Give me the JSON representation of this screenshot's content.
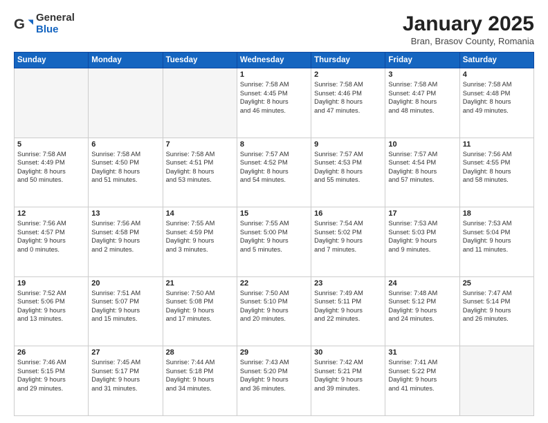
{
  "logo": {
    "general": "General",
    "blue": "Blue"
  },
  "title": "January 2025",
  "location": "Bran, Brasov County, Romania",
  "weekdays": [
    "Sunday",
    "Monday",
    "Tuesday",
    "Wednesday",
    "Thursday",
    "Friday",
    "Saturday"
  ],
  "weeks": [
    [
      {
        "day": "",
        "lines": [],
        "empty": true
      },
      {
        "day": "",
        "lines": [],
        "empty": true
      },
      {
        "day": "",
        "lines": [],
        "empty": true
      },
      {
        "day": "1",
        "lines": [
          "Sunrise: 7:58 AM",
          "Sunset: 4:45 PM",
          "Daylight: 8 hours",
          "and 46 minutes."
        ]
      },
      {
        "day": "2",
        "lines": [
          "Sunrise: 7:58 AM",
          "Sunset: 4:46 PM",
          "Daylight: 8 hours",
          "and 47 minutes."
        ]
      },
      {
        "day": "3",
        "lines": [
          "Sunrise: 7:58 AM",
          "Sunset: 4:47 PM",
          "Daylight: 8 hours",
          "and 48 minutes."
        ]
      },
      {
        "day": "4",
        "lines": [
          "Sunrise: 7:58 AM",
          "Sunset: 4:48 PM",
          "Daylight: 8 hours",
          "and 49 minutes."
        ]
      }
    ],
    [
      {
        "day": "5",
        "lines": [
          "Sunrise: 7:58 AM",
          "Sunset: 4:49 PM",
          "Daylight: 8 hours",
          "and 50 minutes."
        ]
      },
      {
        "day": "6",
        "lines": [
          "Sunrise: 7:58 AM",
          "Sunset: 4:50 PM",
          "Daylight: 8 hours",
          "and 51 minutes."
        ]
      },
      {
        "day": "7",
        "lines": [
          "Sunrise: 7:58 AM",
          "Sunset: 4:51 PM",
          "Daylight: 8 hours",
          "and 53 minutes."
        ]
      },
      {
        "day": "8",
        "lines": [
          "Sunrise: 7:57 AM",
          "Sunset: 4:52 PM",
          "Daylight: 8 hours",
          "and 54 minutes."
        ]
      },
      {
        "day": "9",
        "lines": [
          "Sunrise: 7:57 AM",
          "Sunset: 4:53 PM",
          "Daylight: 8 hours",
          "and 55 minutes."
        ]
      },
      {
        "day": "10",
        "lines": [
          "Sunrise: 7:57 AM",
          "Sunset: 4:54 PM",
          "Daylight: 8 hours",
          "and 57 minutes."
        ]
      },
      {
        "day": "11",
        "lines": [
          "Sunrise: 7:56 AM",
          "Sunset: 4:55 PM",
          "Daylight: 8 hours",
          "and 58 minutes."
        ]
      }
    ],
    [
      {
        "day": "12",
        "lines": [
          "Sunrise: 7:56 AM",
          "Sunset: 4:57 PM",
          "Daylight: 9 hours",
          "and 0 minutes."
        ]
      },
      {
        "day": "13",
        "lines": [
          "Sunrise: 7:56 AM",
          "Sunset: 4:58 PM",
          "Daylight: 9 hours",
          "and 2 minutes."
        ]
      },
      {
        "day": "14",
        "lines": [
          "Sunrise: 7:55 AM",
          "Sunset: 4:59 PM",
          "Daylight: 9 hours",
          "and 3 minutes."
        ]
      },
      {
        "day": "15",
        "lines": [
          "Sunrise: 7:55 AM",
          "Sunset: 5:00 PM",
          "Daylight: 9 hours",
          "and 5 minutes."
        ]
      },
      {
        "day": "16",
        "lines": [
          "Sunrise: 7:54 AM",
          "Sunset: 5:02 PM",
          "Daylight: 9 hours",
          "and 7 minutes."
        ]
      },
      {
        "day": "17",
        "lines": [
          "Sunrise: 7:53 AM",
          "Sunset: 5:03 PM",
          "Daylight: 9 hours",
          "and 9 minutes."
        ]
      },
      {
        "day": "18",
        "lines": [
          "Sunrise: 7:53 AM",
          "Sunset: 5:04 PM",
          "Daylight: 9 hours",
          "and 11 minutes."
        ]
      }
    ],
    [
      {
        "day": "19",
        "lines": [
          "Sunrise: 7:52 AM",
          "Sunset: 5:06 PM",
          "Daylight: 9 hours",
          "and 13 minutes."
        ]
      },
      {
        "day": "20",
        "lines": [
          "Sunrise: 7:51 AM",
          "Sunset: 5:07 PM",
          "Daylight: 9 hours",
          "and 15 minutes."
        ]
      },
      {
        "day": "21",
        "lines": [
          "Sunrise: 7:50 AM",
          "Sunset: 5:08 PM",
          "Daylight: 9 hours",
          "and 17 minutes."
        ]
      },
      {
        "day": "22",
        "lines": [
          "Sunrise: 7:50 AM",
          "Sunset: 5:10 PM",
          "Daylight: 9 hours",
          "and 20 minutes."
        ]
      },
      {
        "day": "23",
        "lines": [
          "Sunrise: 7:49 AM",
          "Sunset: 5:11 PM",
          "Daylight: 9 hours",
          "and 22 minutes."
        ]
      },
      {
        "day": "24",
        "lines": [
          "Sunrise: 7:48 AM",
          "Sunset: 5:12 PM",
          "Daylight: 9 hours",
          "and 24 minutes."
        ]
      },
      {
        "day": "25",
        "lines": [
          "Sunrise: 7:47 AM",
          "Sunset: 5:14 PM",
          "Daylight: 9 hours",
          "and 26 minutes."
        ]
      }
    ],
    [
      {
        "day": "26",
        "lines": [
          "Sunrise: 7:46 AM",
          "Sunset: 5:15 PM",
          "Daylight: 9 hours",
          "and 29 minutes."
        ]
      },
      {
        "day": "27",
        "lines": [
          "Sunrise: 7:45 AM",
          "Sunset: 5:17 PM",
          "Daylight: 9 hours",
          "and 31 minutes."
        ]
      },
      {
        "day": "28",
        "lines": [
          "Sunrise: 7:44 AM",
          "Sunset: 5:18 PM",
          "Daylight: 9 hours",
          "and 34 minutes."
        ]
      },
      {
        "day": "29",
        "lines": [
          "Sunrise: 7:43 AM",
          "Sunset: 5:20 PM",
          "Daylight: 9 hours",
          "and 36 minutes."
        ]
      },
      {
        "day": "30",
        "lines": [
          "Sunrise: 7:42 AM",
          "Sunset: 5:21 PM",
          "Daylight: 9 hours",
          "and 39 minutes."
        ]
      },
      {
        "day": "31",
        "lines": [
          "Sunrise: 7:41 AM",
          "Sunset: 5:22 PM",
          "Daylight: 9 hours",
          "and 41 minutes."
        ]
      },
      {
        "day": "",
        "lines": [],
        "empty": true
      }
    ]
  ]
}
